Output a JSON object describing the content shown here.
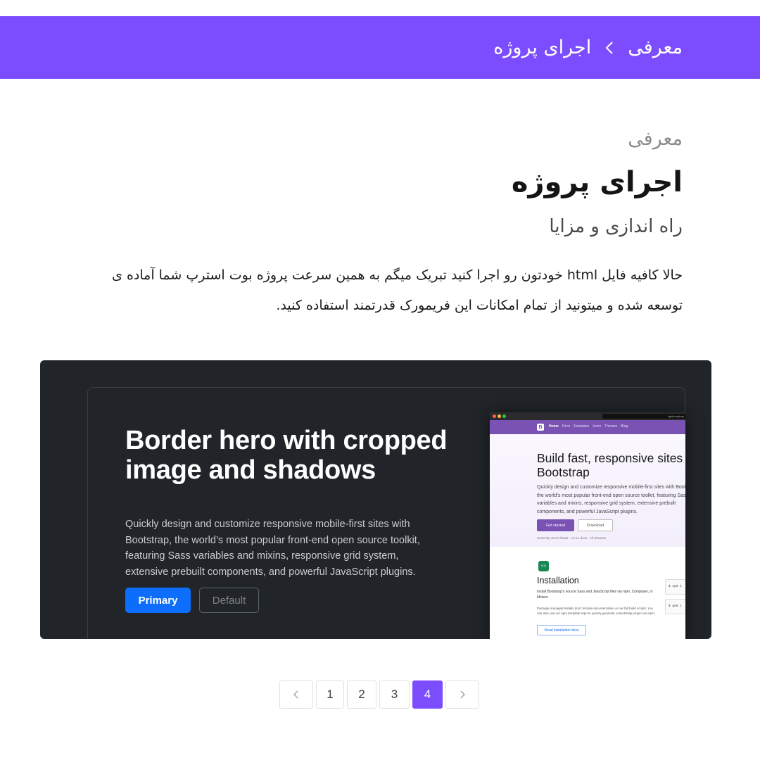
{
  "breadcrumb": {
    "parent": "معرفی",
    "current": "اجرای پروژه"
  },
  "header": {
    "eyebrow": "معرفی",
    "title": "اجرای پروژه",
    "subtitle": "راه اندازی و مزایا",
    "paragraph": "حالا کافیه فایل html خودتون رو اجرا کنید تبریک میگم به همین سرعت پروژه بوت استرپ شما آماده ی توسعه شده و میتونید از تمام امکانات این فریمورک قدرتمند استفاده کنید."
  },
  "preview": {
    "heading": "Border hero with cropped image and shadows",
    "lead": "Quickly design and customize responsive mobile-first sites with Bootstrap, the world’s most popular front-end open source toolkit, featuring Sass variables and mixins, responsive grid system, extensive prebuilt components, and powerful JavaScript plugins.",
    "primary_label": "Primary",
    "default_label": "Default",
    "browser": {
      "url_text": "getbootstrap",
      "logo": "B",
      "nav": [
        "Home",
        "Docs",
        "Examples",
        "Icons",
        "Themes",
        "Blog"
      ],
      "title": "Build fast, responsive sites with Bootstrap",
      "lead": "Quickly design and customize responsive mobile-first sites with Bootstrap, the world’s most popular front-end open source toolkit, featuring Sass variables and mixins, responsive grid system, extensive prebuilt components, and powerful JavaScript plugins.",
      "get_started": "Get started",
      "download": "Download",
      "version": "Currently v5.0.0-beta2 · v4.6.x docs · All releases",
      "install_icon": "<>",
      "install_title": "Installation",
      "install_text": "Install Bootstrap’s source Sass and JavaScript files via npm, Composer, or Meteor.",
      "install_note": "Package managed installs don’t include documentation or our full build scripts. You can also use our npm template repo to quickly generate a Bootstrap project via npm.",
      "read_docs": "Read installation docs",
      "side_box_1": "$ npm i",
      "side_box_2": "$ gem i"
    }
  },
  "pagination": {
    "pages": [
      "1",
      "2",
      "3",
      "4"
    ],
    "active_page": "4",
    "prev_icon": "chevron-left-icon",
    "next_icon": "chevron-right-icon"
  },
  "colors": {
    "accent": "#7c4dff",
    "preview_bg": "#212529",
    "bootstrap_purple": "#7952b3",
    "primary_blue": "#0d6efd"
  }
}
